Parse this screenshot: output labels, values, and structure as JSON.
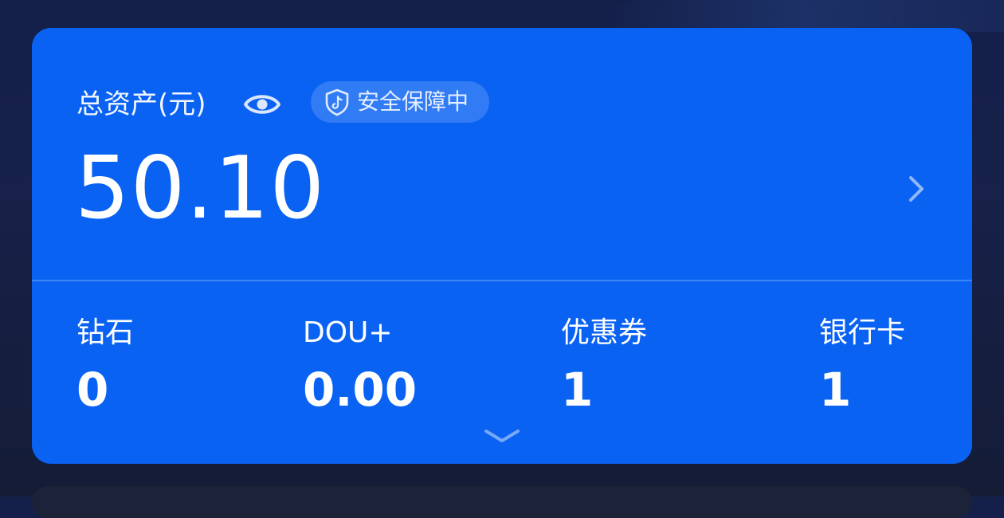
{
  "wallet": {
    "total_label": "总资产(元)",
    "security_badge": "安全保障中",
    "total_value": "50.10",
    "stats": [
      {
        "label": "钻石",
        "value": "0"
      },
      {
        "label": "DOU+",
        "value": "0.00"
      },
      {
        "label": "优惠券",
        "value": "1"
      },
      {
        "label": "银行卡",
        "value": "1"
      }
    ]
  },
  "icons": {
    "eye": "eye-icon",
    "shield": "shield-tiktok-icon",
    "detail": "chevron-right-icon",
    "expand": "chevron-down-icon"
  },
  "colors": {
    "card_background": "#0a62f3",
    "page_background": "#15204a",
    "text": "#ffffff"
  }
}
